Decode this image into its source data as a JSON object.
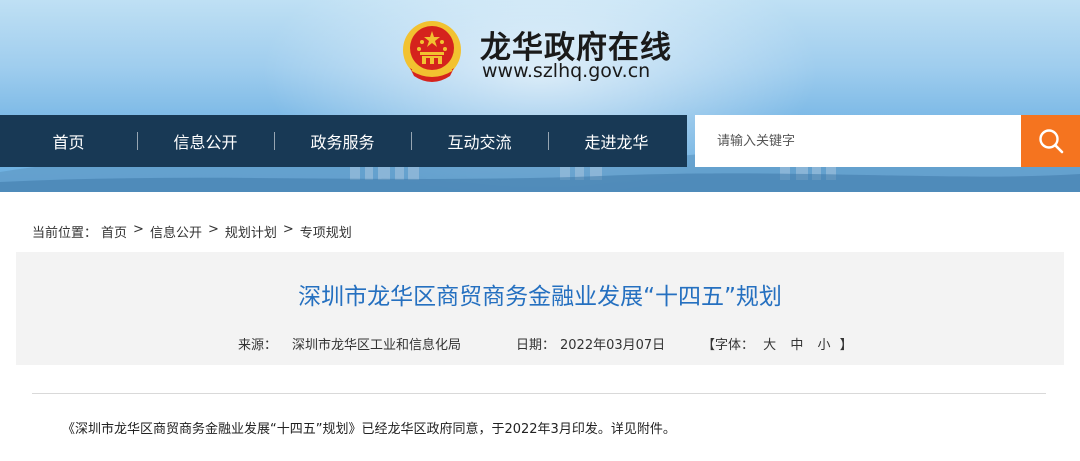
{
  "header": {
    "site_title": "龙华政府在线",
    "site_url": "www.szlhq.gov.cn"
  },
  "nav": {
    "items": [
      {
        "label": "首页"
      },
      {
        "label": "信息公开"
      },
      {
        "label": "政务服务"
      },
      {
        "label": "互动交流"
      },
      {
        "label": "走进龙华"
      }
    ]
  },
  "search": {
    "placeholder": "请输入关键字",
    "icon": "search-icon"
  },
  "breadcrumb": {
    "prefix": "当前位置：",
    "items": [
      "首页",
      "信息公开",
      "规划计划",
      "专项规划"
    ],
    "separator": ">"
  },
  "article": {
    "title": "深圳市龙华区商贸商务金融业发展“十四五”规划",
    "source_label": "来源：",
    "source": "深圳市龙华区工业和信息化局",
    "date_label": "日期：",
    "date": "2022年03月07日",
    "font_label": "【字体：",
    "font_sizes": [
      "大",
      "中",
      "小"
    ],
    "font_close": "】",
    "body": "《深圳市龙华区商贸商务金融业发展“十四五”规划》已经龙华区政府同意，于2022年3月印发。详见附件。"
  },
  "colors": {
    "nav_bg": "#183955",
    "search_button": "#f5741f",
    "title_blue": "#2570c0",
    "emblem_red": "#d5231d",
    "emblem_gold": "#f2c230"
  }
}
